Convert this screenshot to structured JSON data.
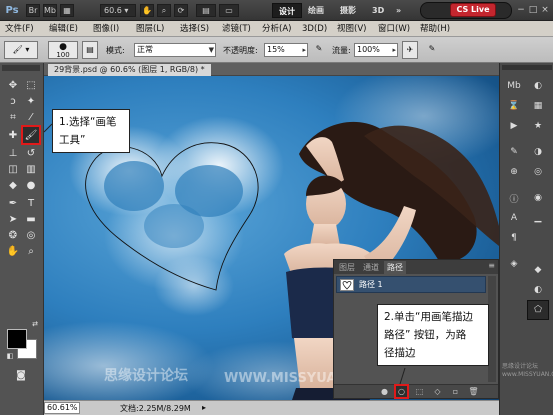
{
  "app": {
    "logo": "Ps"
  },
  "appbar": {
    "zoom_value": "60.6",
    "workspaces": [
      "设计",
      "绘画",
      "摄影",
      "3D"
    ],
    "more": "»",
    "cs_live": "CS Live",
    "window_controls": [
      "−",
      "□",
      "×"
    ]
  },
  "menu": [
    "文件(F)",
    "编辑(E)",
    "图像(I)",
    "图层(L)",
    "选择(S)",
    "滤镜(T)",
    "分析(A)",
    "3D(D)",
    "视图(V)",
    "窗口(W)",
    "帮助(H)"
  ],
  "options_bar": {
    "brush_size": "100",
    "mode_label": "模式:",
    "mode_value": "正常",
    "opacity_label": "不透明度:",
    "opacity_value": "15%",
    "flow_label": "流量:",
    "flow_value": "100%"
  },
  "document": {
    "tab_title": "29背景.psd @ 60.6% (图层 1, RGB/8) *",
    "zoom": "60.61%",
    "doc_size": "文档:2.25M/8.29M"
  },
  "paths_panel": {
    "tabs": [
      "图层",
      "通道",
      "路径"
    ],
    "active_tab": "路径",
    "menu_icon": "≡",
    "path_name": "路径 1",
    "footer_buttons": [
      "fill-path-icon",
      "stroke-path-icon",
      "load-selection-icon",
      "make-work-path-icon",
      "new-path-icon",
      "delete-path-icon"
    ]
  },
  "callouts": {
    "step1": [
      "1.选择“画笔",
      "工具”"
    ],
    "step2": [
      "2.单击“用画笔描边",
      "路径” 按钮，为路",
      "径描边"
    ]
  },
  "watermarks": {
    "bottom_left": "思缘设计论坛",
    "bottom_center": "WWW.MISSYUAN.COM",
    "right_corner": "思缘设计论坛 www.MISSYUAN.COM"
  },
  "colors": {
    "highlight": "#e01a1a",
    "selected_path": "#35506f",
    "cs_live_badge": "#c4262e",
    "foreground": "#000000",
    "background": "#ffffff"
  }
}
